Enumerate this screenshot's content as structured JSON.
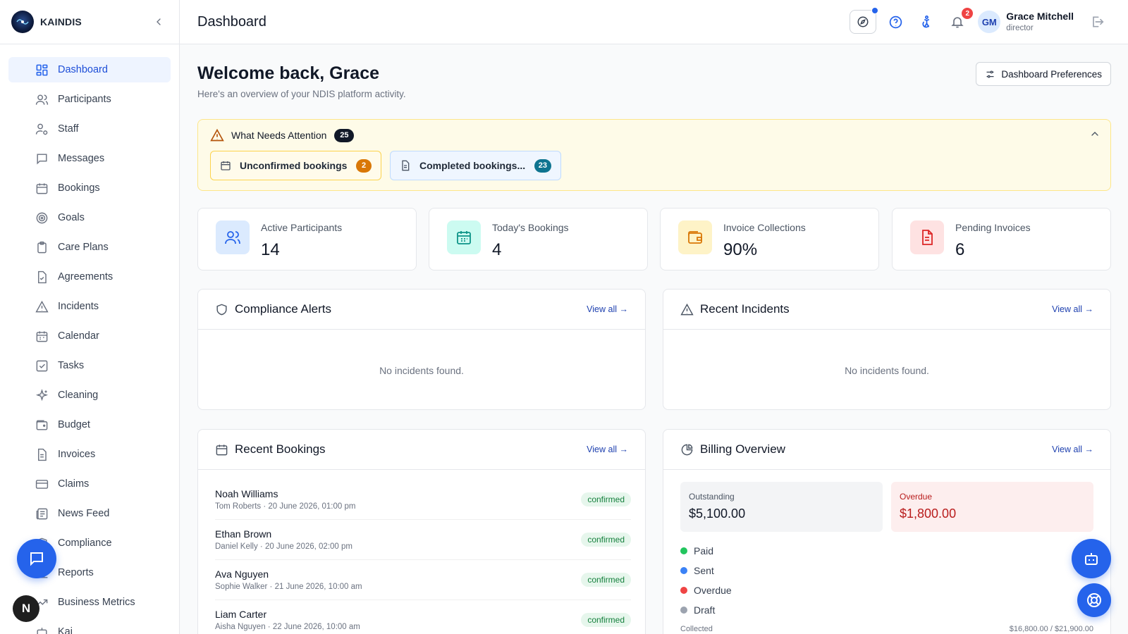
{
  "brand": {
    "name": "KAINDIS"
  },
  "sidebar": {
    "items": [
      {
        "label": "Dashboard",
        "icon": "dashboard-icon",
        "active": true
      },
      {
        "label": "Participants",
        "icon": "users-icon"
      },
      {
        "label": "Staff",
        "icon": "user-cog-icon"
      },
      {
        "label": "Messages",
        "icon": "message-icon"
      },
      {
        "label": "Bookings",
        "icon": "calendar-icon"
      },
      {
        "label": "Goals",
        "icon": "target-icon"
      },
      {
        "label": "Care Plans",
        "icon": "clipboard-icon"
      },
      {
        "label": "Agreements",
        "icon": "file-check-icon"
      },
      {
        "label": "Incidents",
        "icon": "alert-triangle-icon"
      },
      {
        "label": "Calendar",
        "icon": "calendar-icon"
      },
      {
        "label": "Tasks",
        "icon": "check-square-icon"
      },
      {
        "label": "Cleaning",
        "icon": "sparkles-icon"
      },
      {
        "label": "Budget",
        "icon": "wallet-icon"
      },
      {
        "label": "Invoices",
        "icon": "file-text-icon"
      },
      {
        "label": "Claims",
        "icon": "credit-card-icon"
      },
      {
        "label": "News Feed",
        "icon": "newspaper-icon"
      },
      {
        "label": "Compliance",
        "icon": "shield-icon"
      },
      {
        "label": "Reports",
        "icon": "bar-chart-icon"
      },
      {
        "label": "Business Metrics",
        "icon": "trending-up-icon"
      },
      {
        "label": "Kai",
        "icon": "bot-icon"
      }
    ]
  },
  "header": {
    "title": "Dashboard",
    "notifications_count": "2",
    "user": {
      "initials": "GM",
      "name": "Grace Mitchell",
      "role": "director"
    }
  },
  "welcome": {
    "title": "Welcome back, Grace",
    "subtitle": "Here's an overview of your NDIS platform activity.",
    "preferences_label": "Dashboard Preferences"
  },
  "attention": {
    "title": "What Needs Attention",
    "count": "25",
    "items": [
      {
        "label": "Unconfirmed bookings",
        "count": "2"
      },
      {
        "label": "Completed bookings...",
        "count": "23"
      }
    ]
  },
  "stats": [
    {
      "label": "Active Participants",
      "value": "14",
      "icon": "users-icon",
      "color": "#2563eb",
      "bg": "#dbeafe"
    },
    {
      "label": "Today's Bookings",
      "value": "4",
      "icon": "calendar-icon",
      "color": "#0d9488",
      "bg": "#ccfbf1"
    },
    {
      "label": "Invoice Collections",
      "value": "90%",
      "icon": "wallet-icon",
      "color": "#d97706",
      "bg": "#fef3c7"
    },
    {
      "label": "Pending Invoices",
      "value": "6",
      "icon": "file-text-icon",
      "color": "#dc2626",
      "bg": "#fee2e2"
    }
  ],
  "compliance": {
    "title": "Compliance Alerts",
    "view_all": "View all →",
    "empty": "No incidents found."
  },
  "incidents": {
    "title": "Recent Incidents",
    "view_all": "View all →",
    "empty": "No incidents found."
  },
  "bookings": {
    "title": "Recent Bookings",
    "view_all": "View all →",
    "rows": [
      {
        "name": "Noah Williams",
        "sub": "Tom Roberts · 20 June 2026, 01:00 pm",
        "status": "confirmed"
      },
      {
        "name": "Ethan Brown",
        "sub": "Daniel Kelly · 20 June 2026, 02:00 pm",
        "status": "confirmed"
      },
      {
        "name": "Ava Nguyen",
        "sub": "Sophie Walker · 21 June 2026, 10:00 am",
        "status": "confirmed"
      },
      {
        "name": "Liam Carter",
        "sub": "Aisha Nguyen · 22 June 2026, 10:00 am",
        "status": "confirmed"
      }
    ]
  },
  "billing": {
    "title": "Billing Overview",
    "view_all": "View all →",
    "outstanding_label": "Outstanding",
    "outstanding_value": "$5,100.00",
    "overdue_label": "Overdue",
    "overdue_value": "$1,800.00",
    "legend": [
      {
        "label": "Paid",
        "color": "#22c55e"
      },
      {
        "label": "Sent",
        "color": "#3b82f6"
      },
      {
        "label": "Overdue",
        "color": "#ef4444"
      },
      {
        "label": "Draft",
        "color": "#9ca3af"
      }
    ],
    "collected_label": "Collected",
    "collected_value": "$16,800.00 / $21,900.00"
  },
  "floating": {
    "avatar_letter": "N"
  }
}
